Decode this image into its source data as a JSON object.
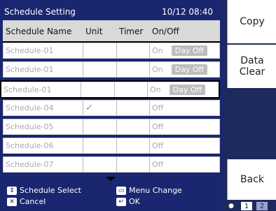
{
  "window": {
    "title": "Schedule Setting",
    "datetime": "10/12 08:40"
  },
  "table": {
    "headers": [
      "Schedule Name",
      "Unit",
      "Timer",
      "On/Off"
    ],
    "rows": [
      {
        "name": "Schedule-01",
        "unit": "",
        "timer": "",
        "state": "On",
        "badge": "Day Off"
      },
      {
        "name": "Schedule-01",
        "unit": "",
        "timer": "",
        "state": "On",
        "badge": "Day Off"
      },
      {
        "name": "Schedule-01",
        "unit": "",
        "timer": "",
        "state": "On",
        "badge": "Day Off"
      },
      {
        "name": "Schedule-04",
        "unit": "✓",
        "timer": "",
        "state": "Off",
        "badge": ""
      },
      {
        "name": "Schedule-05",
        "unit": "",
        "timer": "",
        "state": "Off",
        "badge": ""
      },
      {
        "name": "Schedule-06",
        "unit": "",
        "timer": "",
        "state": "Off",
        "badge": ""
      },
      {
        "name": "Schedule-07",
        "unit": "",
        "timer": "",
        "state": "Off",
        "badge": ""
      }
    ]
  },
  "footer": {
    "select": "Schedule Select",
    "cancel": "Cancel",
    "menu_change": "Menu Change",
    "ok": "OK"
  },
  "side": {
    "copy": "Copy",
    "data": "Data",
    "clear": "Clear",
    "back": "Back"
  },
  "pager": {
    "p1": "1",
    "p2": "2"
  },
  "colors": {
    "background": "#1a2670",
    "header": "#d9d9d9",
    "button": "#ffffff"
  }
}
